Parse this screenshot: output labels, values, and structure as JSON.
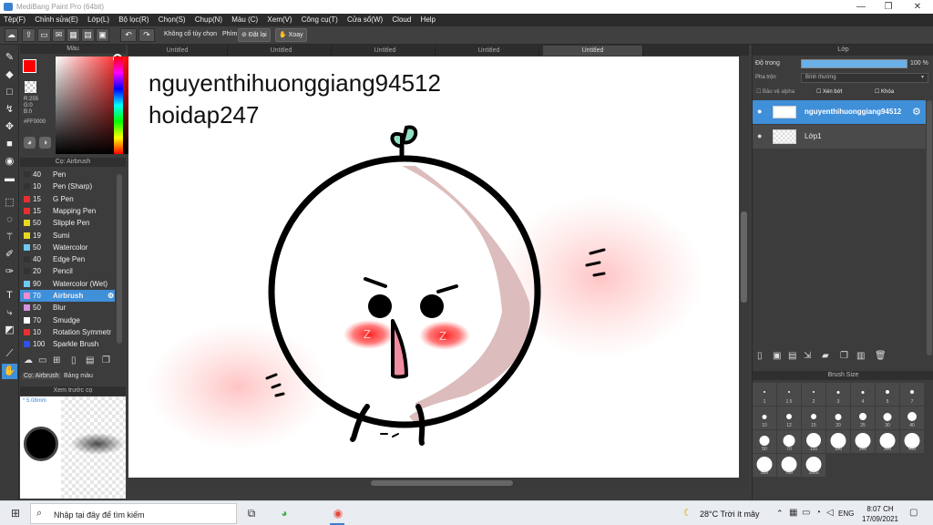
{
  "window": {
    "title": "MediBang Paint Pro (64bit)",
    "controls": [
      "—",
      "❐",
      "✕"
    ]
  },
  "menu": [
    "Tệp(F)",
    "Chỉnh sửa(E)",
    "Lớp(L)",
    "Bộ lọc(R)",
    "Chọn(S)",
    "Chụp(N)",
    "Màu (C)",
    "Xem(V)",
    "Công cụ(T)",
    "Cửa sổ(W)",
    "Cloud",
    "Help"
  ],
  "toolbar": {
    "no_correction": "Không cố tùy chọn",
    "keys_label": "Phím",
    "flip_label": "Đặt lại",
    "rotate_label": "Xoay"
  },
  "color_panel": {
    "title": "Màu",
    "rgb": [
      "R:255",
      "G:0",
      "B:0"
    ],
    "hex": "#FF0000",
    "fg": "#ff0000"
  },
  "brush_panel": {
    "title": "Cọ: Airbrush",
    "brushes": [
      {
        "size": "40",
        "name": "Pen",
        "color": "#333333"
      },
      {
        "size": "10",
        "name": "Pen (Sharp)",
        "color": "#333333"
      },
      {
        "size": "15",
        "name": "G Pen",
        "color": "#e83030"
      },
      {
        "size": "15",
        "name": "Mapping Pen",
        "color": "#e83030"
      },
      {
        "size": "50",
        "name": "Slipple Pen",
        "color": "#e8d820"
      },
      {
        "size": "19",
        "name": "Sumi",
        "color": "#e8d820"
      },
      {
        "size": "50",
        "name": "Watercolor",
        "color": "#6ec8f0"
      },
      {
        "size": "40",
        "name": "Edge Pen",
        "color": "#333333"
      },
      {
        "size": "20",
        "name": "Pencil",
        "color": "#333333"
      },
      {
        "size": "90",
        "name": "Watercolor (Wet)",
        "color": "#6ec8f0"
      },
      {
        "size": "70",
        "name": "Airbrush",
        "color": "#f08ccc"
      },
      {
        "size": "50",
        "name": "Blur",
        "color": "#d890e0"
      },
      {
        "size": "70",
        "name": "Smudge",
        "color": "#ffffff"
      },
      {
        "size": "10",
        "name": "Rotation Symmetr",
        "color": "#e83030"
      },
      {
        "size": "100",
        "name": "Sparkle Brush",
        "color": "#3050e8"
      }
    ],
    "selected_index": 10,
    "tabs": [
      "Cọ: Airbrush",
      "Bảng màu"
    ]
  },
  "preview_panel": {
    "title": "Xem trước cọ",
    "size_text": "5.08mm"
  },
  "canvas_tabs": [
    "Untitled",
    "Untitled",
    "Untitled",
    "Untitled",
    "Untitled"
  ],
  "canvas": {
    "text_line1": "nguyenthihuonggiang94512",
    "text_line2": "hoidap247",
    "blush_mark": "Z"
  },
  "layer_panel": {
    "title": "Lớp",
    "opacity_label": "Độ trong",
    "opacity_value": "100 %",
    "blend_label": "Pha trộn",
    "blend_value": "Bình thường",
    "protect_alpha": "Bảo vệ alpha",
    "clipping": "Xén bớt",
    "lock": "Khóa",
    "layers": [
      {
        "name": "nguyenthihuonggiang94512",
        "selected": true
      },
      {
        "name": "Lớp1",
        "selected": false
      }
    ]
  },
  "brush_size_panel": {
    "title": "Brush Size",
    "sizes": [
      "1",
      "1.5",
      "2",
      "3",
      "4",
      "5",
      "7",
      "10",
      "12",
      "15",
      "20",
      "25",
      "30",
      "40",
      "50",
      "70",
      "100",
      "150",
      "200",
      "300",
      "400",
      "500",
      "700",
      "1000"
    ]
  },
  "taskbar": {
    "search_placeholder": "Nhập tại đây để tìm kiếm",
    "weather": "28°C  Trời ít mây",
    "lang": "ENG",
    "time": "8:07 CH",
    "date": "17/09/2021"
  }
}
